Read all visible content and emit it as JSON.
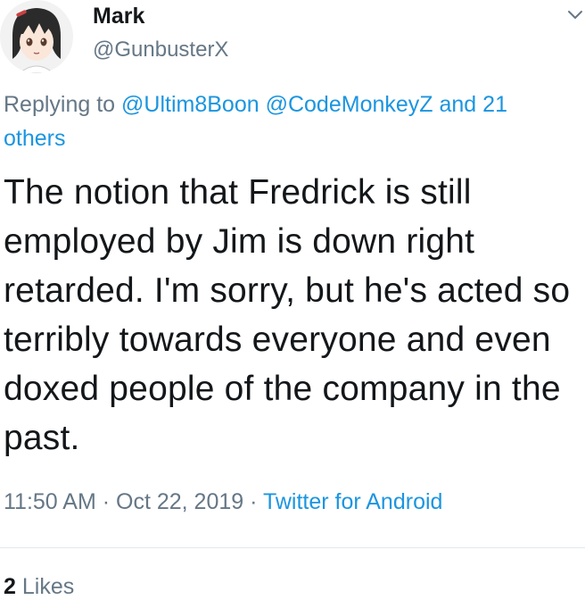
{
  "author": {
    "display_name": "Mark",
    "handle": "@GunbusterX"
  },
  "reply": {
    "prefix": "Replying to",
    "mentions": [
      "@Ultim8Boon",
      "@CodeMonkeyZ"
    ],
    "connector": "and",
    "others": "21 others"
  },
  "tweet": {
    "text": "The notion that Fredrick is still employed by Jim is down right retarded. I'm sorry, but he's acted so terribly towards everyone and even doxed people of the company in the past."
  },
  "meta": {
    "time": "11:50 AM",
    "date": "Oct 22, 2019",
    "separator": "·",
    "source": "Twitter for Android"
  },
  "stats": {
    "likes_count": "2",
    "likes_label": "Likes"
  },
  "icons": {
    "menu": "chevron-down-icon"
  },
  "colors": {
    "link": "#1b95e0",
    "secondary_text": "#657786",
    "primary_text": "#14171a",
    "divider": "#e1e8ed"
  }
}
